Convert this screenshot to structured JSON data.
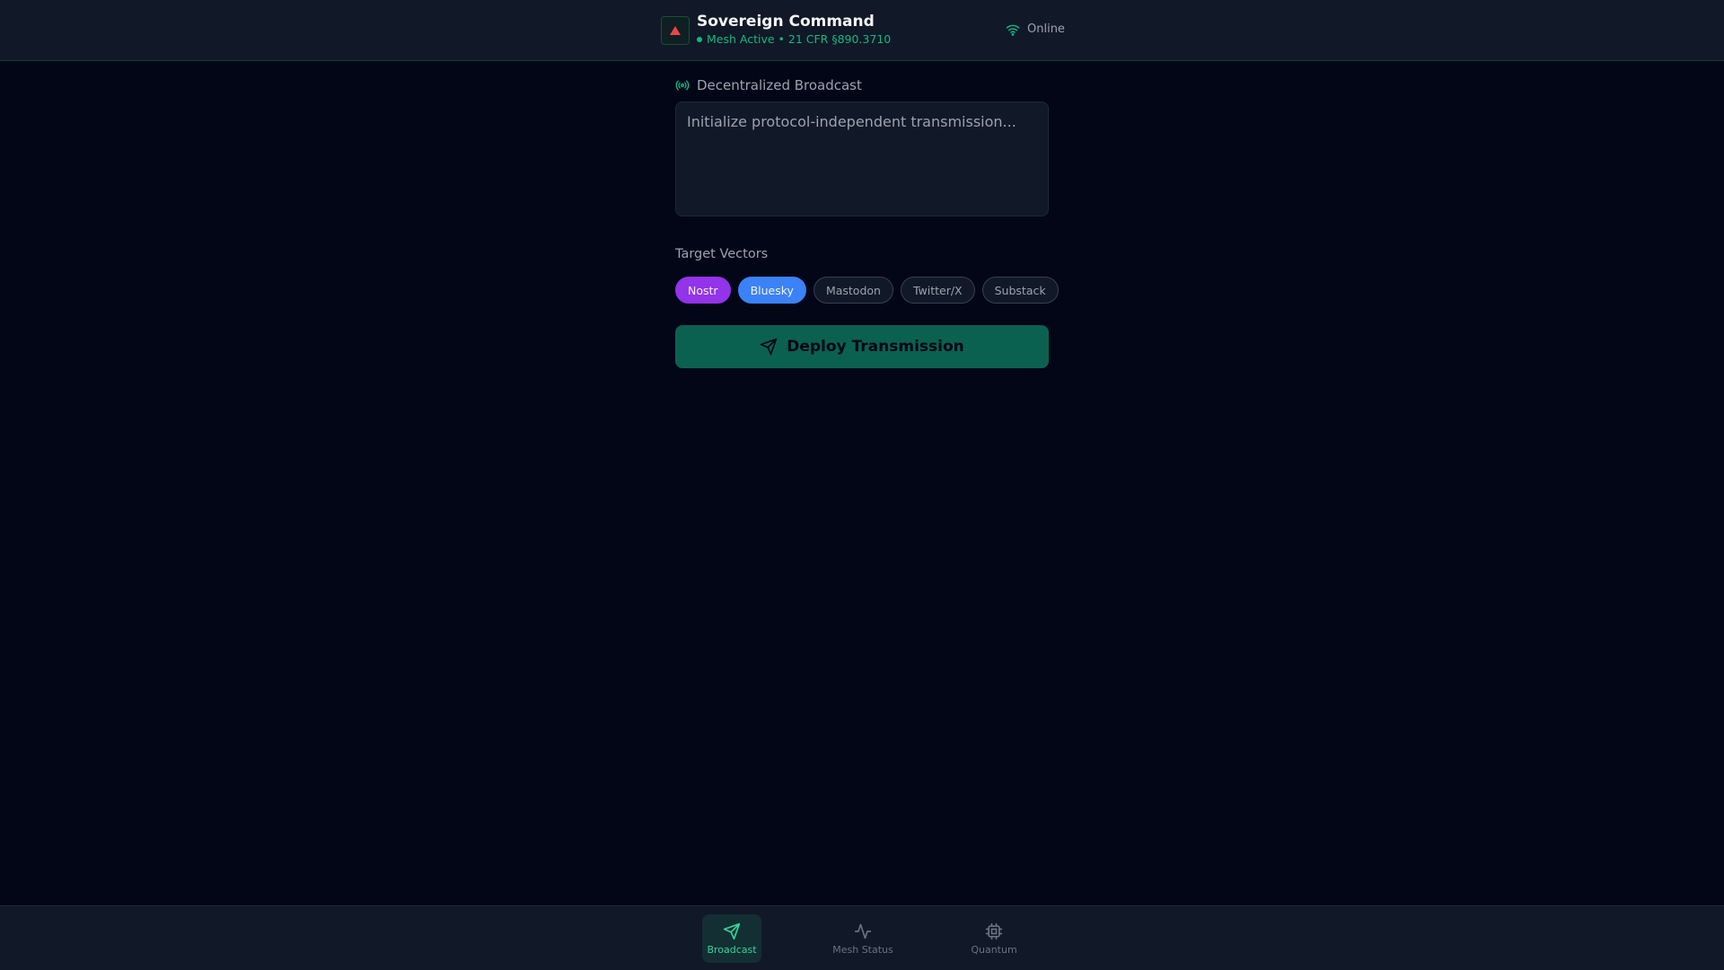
{
  "header": {
    "title": "Sovereign Command",
    "status": "Mesh Active • 21 CFR §890.3710",
    "connection": "Online"
  },
  "broadcast": {
    "label": "Decentralized Broadcast",
    "placeholder": "Initialize protocol-independent transmission...",
    "value": ""
  },
  "targets": {
    "label": "Target Vectors",
    "chips": [
      {
        "label": "Nostr",
        "selected": true,
        "color": "#9333ea"
      },
      {
        "label": "Bluesky",
        "selected": true,
        "color": "#3b82f6"
      },
      {
        "label": "Mastodon",
        "selected": false
      },
      {
        "label": "Twitter/X",
        "selected": false
      },
      {
        "label": "Substack",
        "selected": false
      }
    ]
  },
  "deploy_label": "Deploy Transmission",
  "nav": {
    "items": [
      {
        "label": "Broadcast",
        "active": true
      },
      {
        "label": "Mesh Status",
        "active": false
      },
      {
        "label": "Quantum",
        "active": false
      }
    ]
  }
}
